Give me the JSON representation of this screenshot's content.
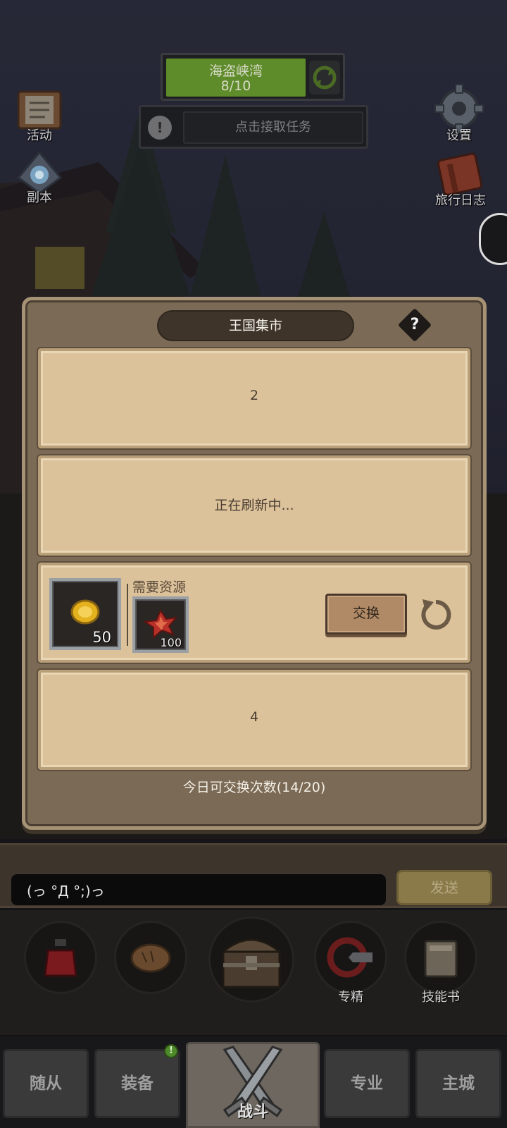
{
  "hud": {
    "stage_name": "海盗峡湾",
    "stage_progress": "8/10",
    "task_prompt": "点击接取任务"
  },
  "side_buttons": {
    "activity": "活动",
    "dungeon": "副本",
    "settings": "设置",
    "travel_log": "旅行日志"
  },
  "market": {
    "title": "王国集市",
    "help": "?",
    "slots": [
      {
        "text": "2"
      },
      {
        "text": "正在刷新中..."
      },
      {
        "reward_qty": "50",
        "need_label": "需要资源",
        "cost_qty": "100",
        "exchange_label": "交换"
      },
      {
        "text": "4"
      }
    ],
    "daily_limit": "今日可交换次数(14/20)"
  },
  "chat": {
    "input_value": "(っ °Д °;)っ",
    "send_label": "发送"
  },
  "actions": {
    "specialize": "专精",
    "skill_book": "技能书"
  },
  "nav": {
    "followers": "随从",
    "equipment": "装备",
    "battle": "战斗",
    "profession": "专业",
    "main_city": "主城",
    "equipment_badge": "!"
  },
  "colors": {
    "parchment": "#dcc29a",
    "modal_brown": "#7b6a55",
    "stage_green": "#5f8c2a"
  }
}
